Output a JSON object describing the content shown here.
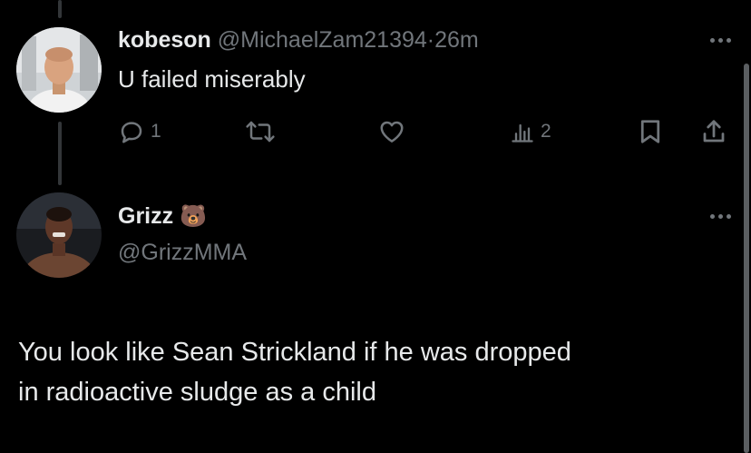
{
  "reply_tweet": {
    "display_name": "kobeson",
    "handle": "@MichaelZam21394",
    "separator": "·",
    "time": "26m",
    "text": "U failed miserably",
    "actions": {
      "reply_count": "1",
      "retweet_count": "",
      "like_count": "",
      "views_count": "2"
    }
  },
  "main_tweet": {
    "display_name": "Grizz",
    "emoji": "🐻",
    "handle": "@GrizzMMA",
    "text_line1": "You look like Sean Strickland if he was dropped",
    "text_line2": "in radioactive sludge as a child"
  },
  "colors": {
    "background": "#000000",
    "primary_text": "#e7e9ea",
    "secondary_text": "#71767b",
    "thread_line": "#333639"
  }
}
